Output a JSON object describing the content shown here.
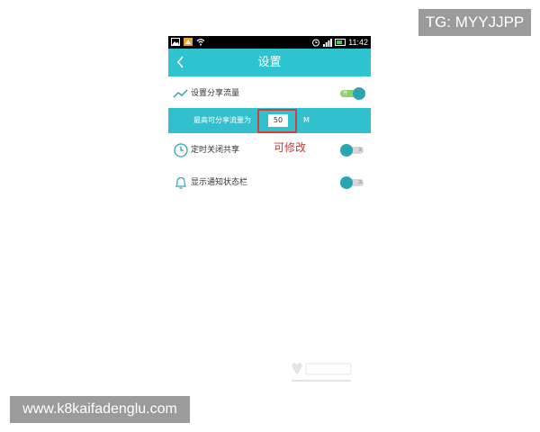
{
  "status_bar": {
    "time": "11:42",
    "left_icons": [
      "image-icon",
      "app-notification-icon",
      "wifi-icon"
    ],
    "right_icons": [
      "alarm-icon",
      "signal-icon",
      "battery-icon"
    ],
    "accent": "#2ec4cf"
  },
  "titlebar": {
    "title": "设置",
    "back_icon": "chevron-left-icon",
    "color": "#2ec4cf"
  },
  "settings": {
    "share_traffic": {
      "label": "设置分享流量",
      "icon": "trend-line-icon",
      "toggle_on": true,
      "toggle_text": "开"
    },
    "max_share": {
      "label": "最高可分享流量为",
      "value": "50",
      "unit": "M"
    },
    "timed_close": {
      "label": "定时关闭共享",
      "icon": "clock-icon",
      "toggle_on": false,
      "toggle_text": "关"
    },
    "notification_bar": {
      "label": "显示通知状态栏",
      "icon": "bell-icon",
      "toggle_on": false,
      "toggle_text": "关"
    }
  },
  "annotation": {
    "text": "可修改",
    "color": "#c43b37"
  },
  "overlays": {
    "tg": "TG: MYYJJPP",
    "site": "www.k8kaifadenglu.com"
  }
}
